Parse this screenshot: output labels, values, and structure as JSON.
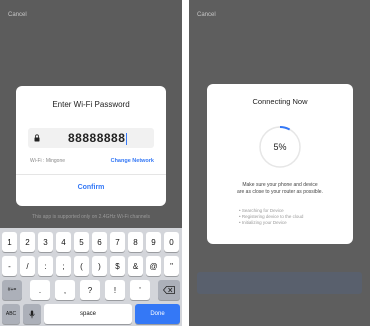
{
  "left_screen": {
    "cancel": "Cancel",
    "dialog": {
      "title": "Enter Wi-Fi Password",
      "password": "88888888",
      "wifi_label": "Wi-Fi : Mingone",
      "change_network": "Change Network",
      "confirm": "Confirm"
    },
    "note": "This app is supported only on 2.4GHz Wi-Fi channels",
    "keyboard": {
      "row1": [
        "1",
        "2",
        "3",
        "4",
        "5",
        "6",
        "7",
        "8",
        "9",
        "0"
      ],
      "row2": [
        "-",
        "/",
        ":",
        ";",
        "(",
        ")",
        "$",
        "&",
        "@",
        "\""
      ],
      "row3_left": "#+=",
      "row3": [
        ".",
        ",",
        "?",
        "!",
        "'"
      ],
      "row4_abc": "ABC",
      "row4_space": "space",
      "row4_done": "Done"
    }
  },
  "right_screen": {
    "cancel": "Cancel",
    "dialog": {
      "title": "Connecting Now",
      "progress_percent": 5,
      "progress_label": "5%",
      "message_line1": "Make sure your phone and device",
      "message_line2": "are as close to your router as possible.",
      "steps": [
        "Searching for Device",
        "Registering device to the cloud",
        "Initializing your Device"
      ]
    }
  },
  "colors": {
    "accent": "#3478f6",
    "overlay": "#5c5c5c",
    "keyboard": "#d3d5da"
  }
}
